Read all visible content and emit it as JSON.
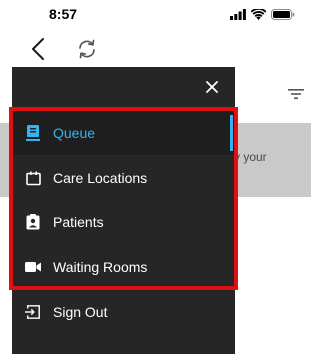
{
  "status_bar": {
    "time": "8:57",
    "icons": [
      "signal-icon",
      "wifi-icon",
      "battery-icon"
    ]
  },
  "nav": {
    "back_icon": "chevron-left-icon",
    "refresh_icon": "refresh-icon"
  },
  "background": {
    "partial_text": "y your",
    "filter_icon": "filter-icon"
  },
  "drawer": {
    "close_icon": "close-icon",
    "items": [
      {
        "label": "Queue",
        "icon": "queue-icon",
        "active": true
      },
      {
        "label": "Care Locations",
        "icon": "care-locations-icon",
        "active": false
      },
      {
        "label": "Patients",
        "icon": "patients-icon",
        "active": false
      },
      {
        "label": "Waiting Rooms",
        "icon": "waiting-rooms-icon",
        "active": false
      }
    ],
    "sign_out": {
      "label": "Sign Out",
      "icon": "sign-out-icon"
    }
  },
  "colors": {
    "drawer_bg": "#262626",
    "active_accent": "#35b3f0",
    "highlight": "#e01010",
    "overlay_gray": "#c9c9c9"
  }
}
